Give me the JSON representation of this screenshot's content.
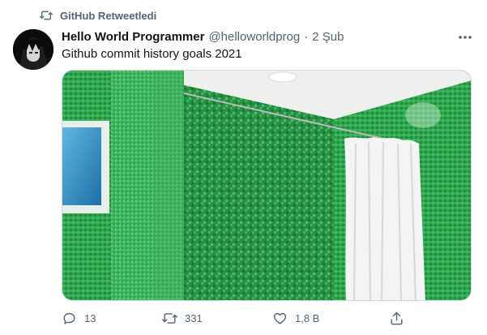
{
  "retweet": {
    "label": "GitHub Retweetledi"
  },
  "tweet": {
    "author_name": "Hello World Programmer",
    "handle": "@helloworldprog",
    "separator": "·",
    "date": "2 Şub",
    "text": "Github commit history goals 2021"
  },
  "actions": {
    "reply_count": "13",
    "retweet_count": "331",
    "like_count": "1,8 B"
  },
  "colors": {
    "secondary_text": "#536471",
    "tile_green": "#2fa34e",
    "ceiling": "#eef0ee"
  }
}
